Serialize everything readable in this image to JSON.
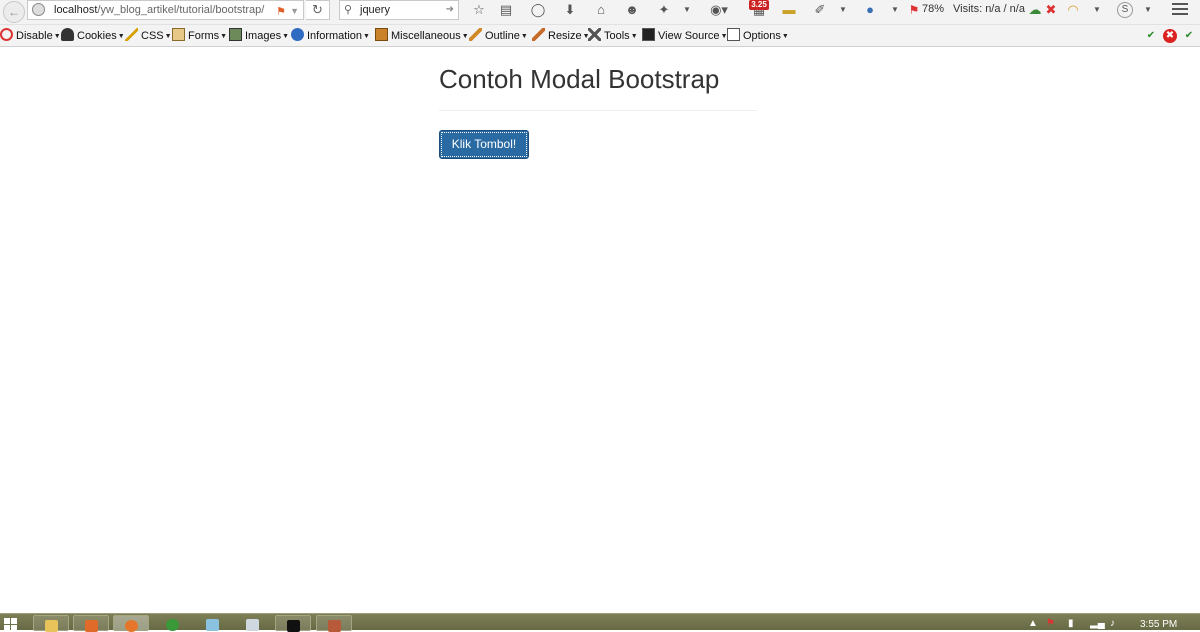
{
  "browser": {
    "url_host": "localhost",
    "url_path": "/yw_blog_artikel/tutorial/bootstrap/",
    "search_value": "jquery",
    "badge_count": "3.25",
    "zoom_percent": "78%",
    "visits_text": "Visits: n/a / n/a",
    "profile_initial": "S"
  },
  "webdev_toolbar": {
    "items": [
      {
        "label": "Disable",
        "icon": "disable-icon"
      },
      {
        "label": "Cookies",
        "icon": "cookies-icon"
      },
      {
        "label": "CSS",
        "icon": "css-icon"
      },
      {
        "label": "Forms",
        "icon": "forms-icon"
      },
      {
        "label": "Images",
        "icon": "images-icon"
      },
      {
        "label": "Information",
        "icon": "information-icon"
      },
      {
        "label": "Miscellaneous",
        "icon": "miscellaneous-icon"
      },
      {
        "label": "Outline",
        "icon": "outline-icon"
      },
      {
        "label": "Resize",
        "icon": "resize-icon"
      },
      {
        "label": "Tools",
        "icon": "tools-icon"
      },
      {
        "label": "View Source",
        "icon": "view-source-icon"
      },
      {
        "label": "Options",
        "icon": "options-icon"
      }
    ]
  },
  "page": {
    "title": "Contoh Modal Bootstrap",
    "button_label": "Klik Tombol!"
  },
  "taskbar": {
    "clock": "3:55 PM"
  },
  "colors": {
    "button_bg": "#2a6aa3",
    "taskbar_bg": "#6f714b",
    "badge": "#cc2222"
  }
}
